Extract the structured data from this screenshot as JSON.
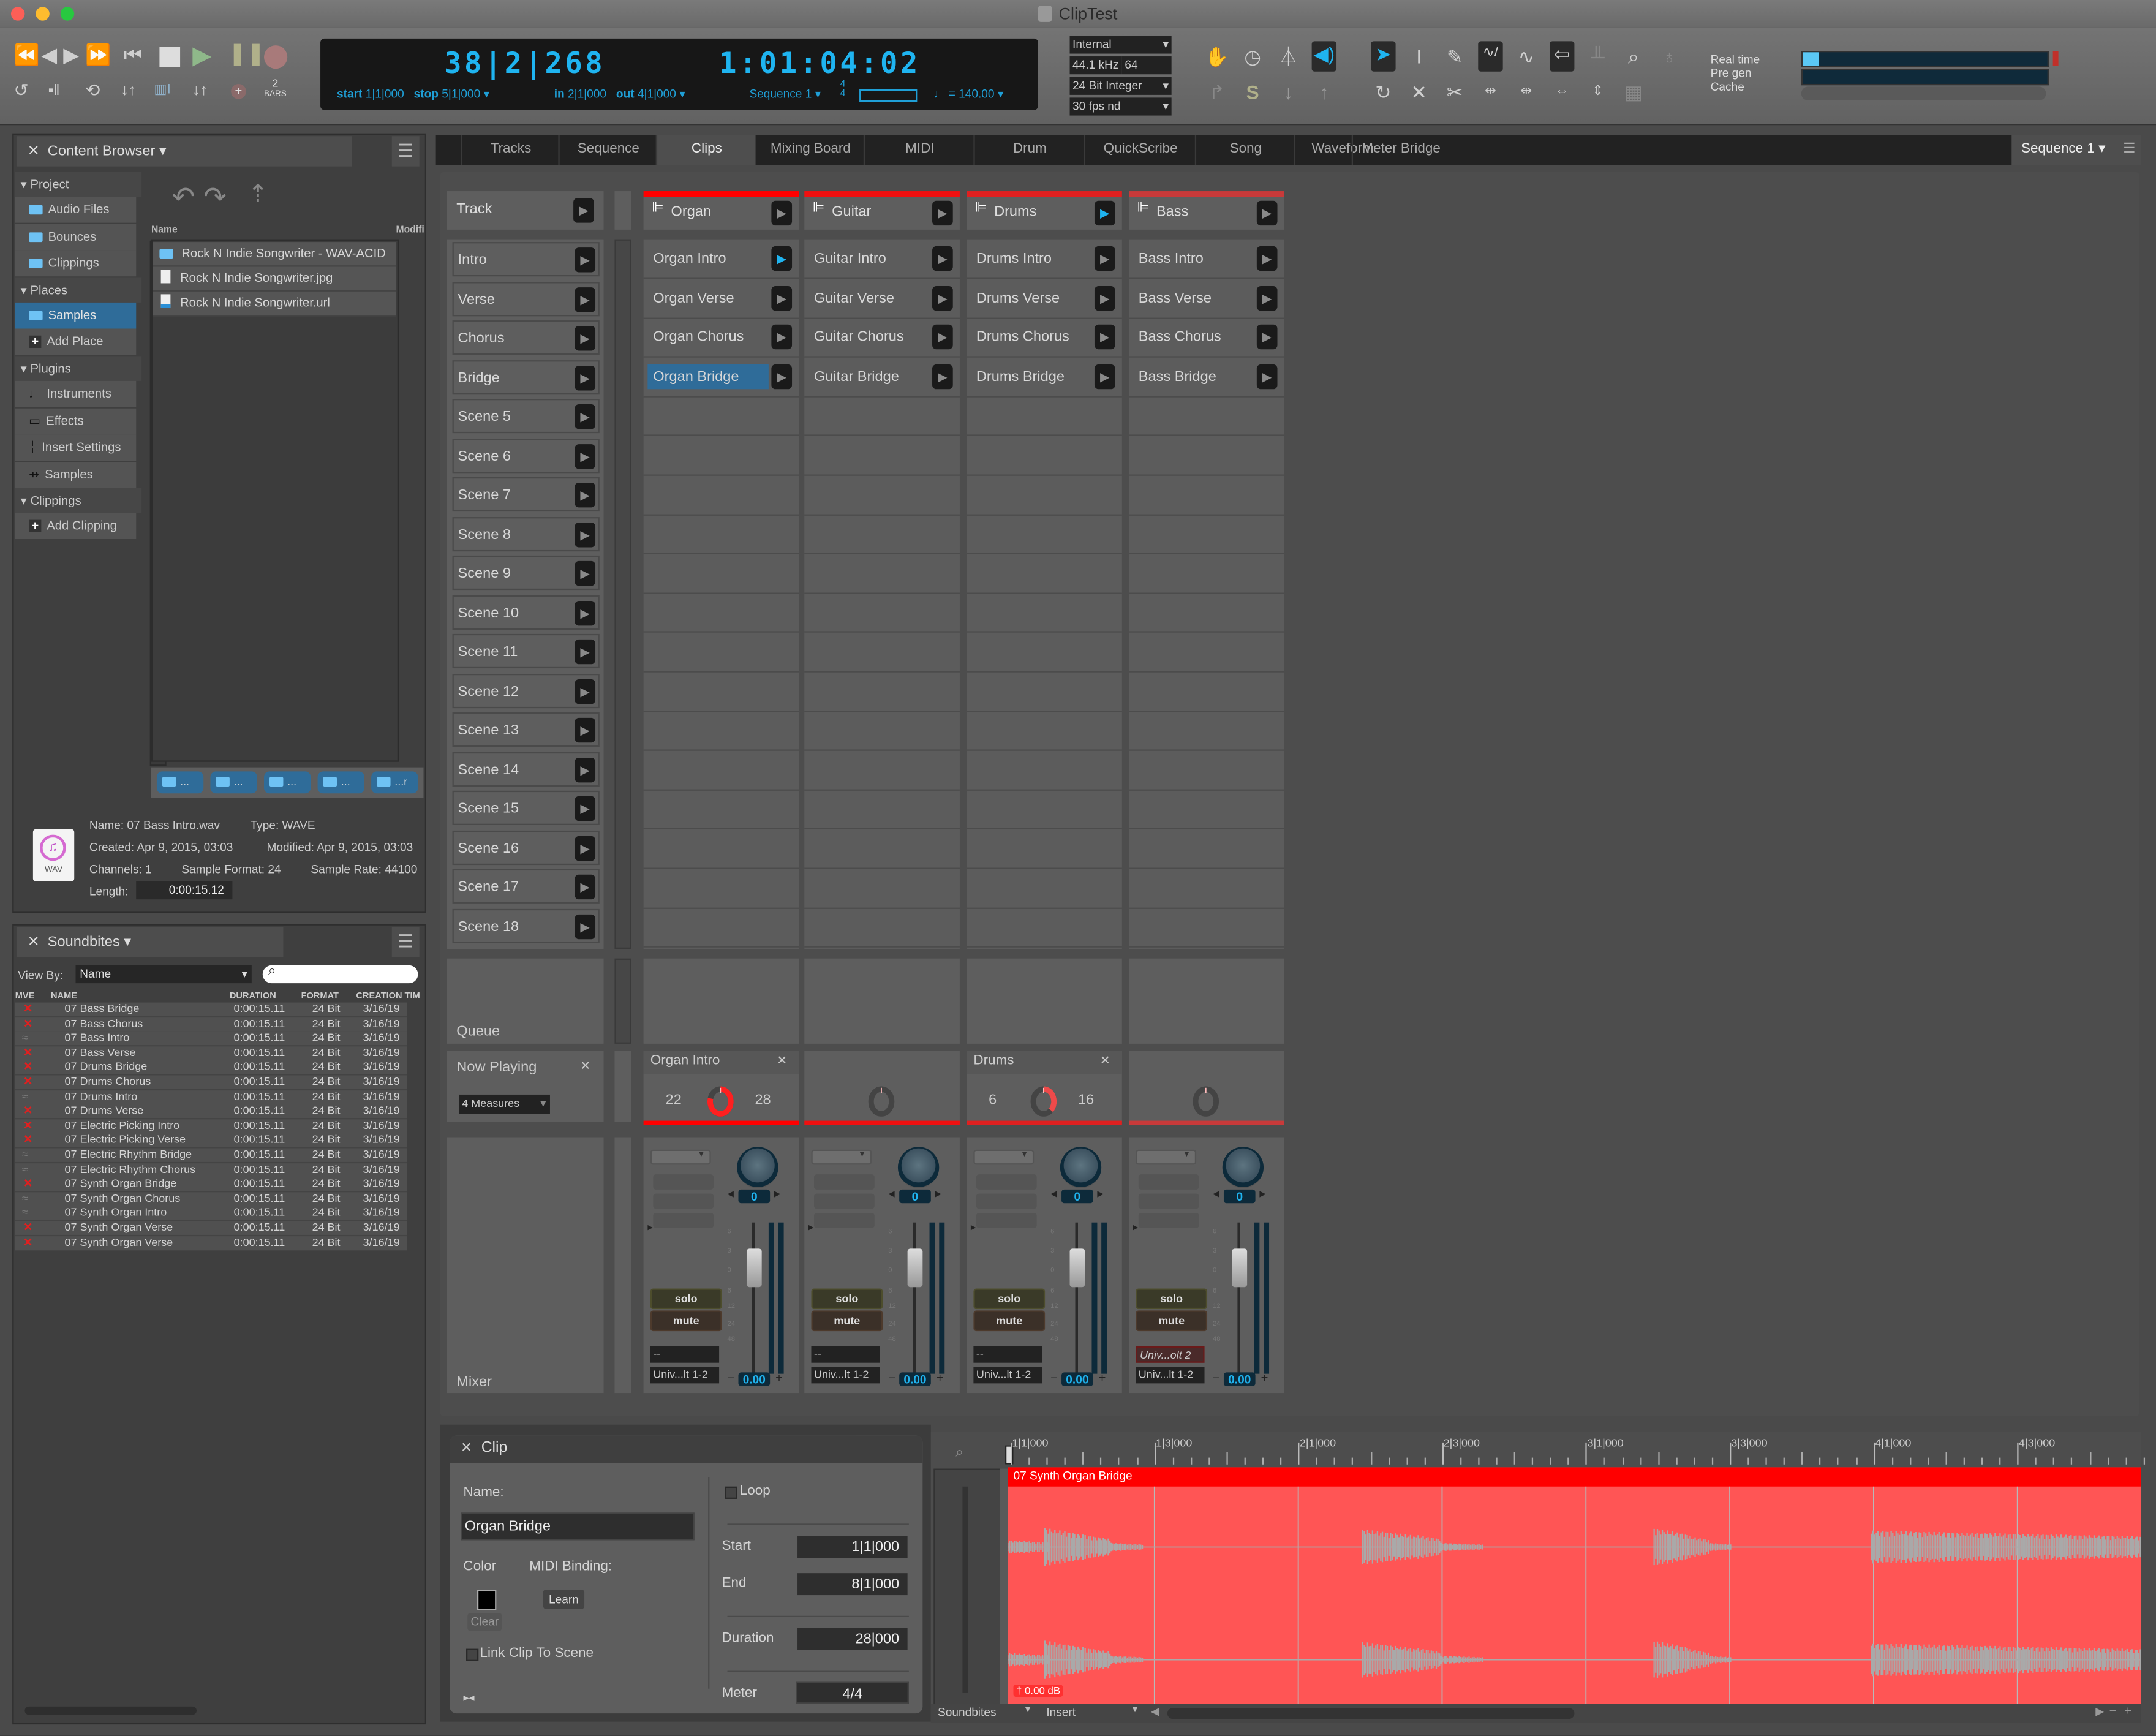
{
  "window": {
    "title": "ClipTest"
  },
  "transport": {
    "position_bars": "38|2|268",
    "position_time": "1:01:04:02",
    "start_label": "start",
    "start_value": "1|1|000",
    "stop_label": "stop",
    "stop_value": "5|1|000",
    "in_label": "in",
    "in_value": "2|1|000",
    "out_label": "out",
    "out_value": "4|1|000",
    "sequence": "Sequence 1",
    "meter_top": "4",
    "meter_bottom": "4",
    "tempo": "= 140.00",
    "bars_count": "2",
    "bars_label": "BARS"
  },
  "audio_settings": {
    "sync": "Internal",
    "sample_rate": "44.1 kHz",
    "buffer": "64",
    "bit_depth": "24 Bit Integer",
    "frame_rate": "30 fps nd"
  },
  "meters": {
    "labels": [
      "Real time",
      "Pre gen",
      "Cache"
    ],
    "realtime_fraction": 0.07,
    "colors": {
      "fill": "#5bc8f5",
      "track": "#0f2a3a",
      "clip": "#c0302a"
    }
  },
  "content_browser": {
    "title": "Content Browser",
    "tree": [
      {
        "type": "header",
        "label": "Project"
      },
      {
        "type": "item",
        "icon": "folder-icon",
        "label": "Audio Files"
      },
      {
        "type": "item",
        "icon": "folder-icon",
        "label": "Bounces"
      },
      {
        "type": "item",
        "icon": "folder-icon",
        "label": "Clippings"
      },
      {
        "type": "header",
        "label": "Places"
      },
      {
        "type": "item",
        "icon": "folder-icon",
        "label": "Samples",
        "selected": true
      },
      {
        "type": "item",
        "icon": "plus-icon",
        "label": "Add Place"
      },
      {
        "type": "header",
        "label": "Plugins"
      },
      {
        "type": "item",
        "icon": "note-icon",
        "label": "Instruments"
      },
      {
        "type": "item",
        "icon": "effects-icon",
        "label": "Effects"
      },
      {
        "type": "item",
        "icon": "insert-icon",
        "label": "Insert Settings"
      },
      {
        "type": "item",
        "icon": "samples-icon",
        "label": "Samples"
      },
      {
        "type": "header",
        "label": "Clippings"
      },
      {
        "type": "item",
        "icon": "plus-icon",
        "label": "Add Clipping"
      }
    ],
    "columns": [
      "Name",
      "Modifi"
    ],
    "files": [
      {
        "icon": "folder-icon",
        "name": "Rock N Indie Songwriter - WAV-ACID"
      },
      {
        "icon": "image-file-icon",
        "name": "Rock N Indie Songwriter.jpg"
      },
      {
        "icon": "url-file-icon",
        "name": "Rock N Indie Songwriter.url"
      }
    ],
    "breadcrumbs": [
      "...",
      "...",
      "...",
      "...",
      "...r"
    ],
    "info": {
      "name": "Name: 07 Bass Intro.wav",
      "type": "Type: WAVE",
      "created": "Created: Apr 9, 2015, 03:03",
      "modified": "Modified: Apr 9, 2015, 03:03",
      "channels": "Channels: 1",
      "sample_format": "Sample Format: 24",
      "sample_rate": "Sample Rate: 44100",
      "length_label": "Length:",
      "length_value": "0:00:15.12",
      "file_badge": "WAV"
    }
  },
  "soundbites": {
    "title": "Soundbites",
    "view_by_label": "View By:",
    "view_by_value": "Name",
    "search_placeholder": "",
    "columns": [
      "MVE",
      "NAME",
      "DURATION",
      "FORMAT",
      "CREATION TIM"
    ],
    "rows": [
      {
        "status": "x",
        "name": "07 Bass Bridge",
        "duration": "0:00:15.11",
        "format": "24 Bit",
        "created": "3/16/19"
      },
      {
        "status": "x",
        "name": "07 Bass Chorus",
        "duration": "0:00:15.11",
        "format": "24 Bit",
        "created": "3/16/19"
      },
      {
        "status": "wave",
        "name": "07 Bass Intro",
        "duration": "0:00:15.11",
        "format": "24 Bit",
        "created": "3/16/19"
      },
      {
        "status": "x",
        "name": "07 Bass Verse",
        "duration": "0:00:15.11",
        "format": "24 Bit",
        "created": "3/16/19"
      },
      {
        "status": "x",
        "name": "07 Drums Bridge",
        "duration": "0:00:15.11",
        "format": "24 Bit",
        "created": "3/16/19"
      },
      {
        "status": "x",
        "name": "07 Drums Chorus",
        "duration": "0:00:15.11",
        "format": "24 Bit",
        "created": "3/16/19"
      },
      {
        "status": "wave",
        "name": "07 Drums Intro",
        "duration": "0:00:15.11",
        "format": "24 Bit",
        "created": "3/16/19"
      },
      {
        "status": "x",
        "name": "07 Drums Verse",
        "duration": "0:00:15.11",
        "format": "24 Bit",
        "created": "3/16/19"
      },
      {
        "status": "x",
        "name": "07 Electric Picking Intro",
        "duration": "0:00:15.11",
        "format": "24 Bit",
        "created": "3/16/19"
      },
      {
        "status": "x",
        "name": "07 Electric Picking Verse",
        "duration": "0:00:15.11",
        "format": "24 Bit",
        "created": "3/16/19"
      },
      {
        "status": "wave",
        "name": "07 Electric Rhythm Bridge",
        "duration": "0:00:15.11",
        "format": "24 Bit",
        "created": "3/16/19"
      },
      {
        "status": "wave",
        "name": "07 Electric Rhythm Chorus",
        "duration": "0:00:15.11",
        "format": "24 Bit",
        "created": "3/16/19"
      },
      {
        "status": "x",
        "name": "07 Synth Organ Bridge",
        "duration": "0:00:15.11",
        "format": "24 Bit",
        "created": "3/16/19"
      },
      {
        "status": "wave",
        "name": "07 Synth Organ Chorus",
        "duration": "0:00:15.11",
        "format": "24 Bit",
        "created": "3/16/19"
      },
      {
        "status": "wave",
        "name": "07 Synth Organ Intro",
        "duration": "0:00:15.11",
        "format": "24 Bit",
        "created": "3/16/19"
      },
      {
        "status": "x",
        "name": "07 Synth Organ Verse",
        "duration": "0:00:15.11",
        "format": "24 Bit",
        "created": "3/16/19"
      },
      {
        "status": "x",
        "name": "07 Synth Organ Verse",
        "duration": "0:00:15.11",
        "format": "24 Bit",
        "created": "3/16/19"
      }
    ]
  },
  "tabs": {
    "items": [
      "Tracks",
      "Sequence",
      "Clips",
      "Mixing Board",
      "MIDI",
      "Drum",
      "QuickScribe",
      "Song",
      "Waveform",
      "Meter Bridge"
    ],
    "active": "Clips",
    "sequence_selector": "Sequence 1"
  },
  "clips": {
    "track_header_label": "Track",
    "tracks": [
      {
        "name": "Organ",
        "color": "#ff0000",
        "play_active": false
      },
      {
        "name": "Guitar",
        "color": "#f01010",
        "play_active": false
      },
      {
        "name": "Drums",
        "color": "#e02020",
        "play_active": true
      },
      {
        "name": "Bass",
        "color": "#c83a3a",
        "play_active": false
      }
    ],
    "scenes": [
      "Intro",
      "Verse",
      "Chorus",
      "Bridge",
      "Scene 5",
      "Scene 6",
      "Scene 7",
      "Scene 8",
      "Scene 9",
      "Scene 10",
      "Scene 11",
      "Scene 12",
      "Scene 13",
      "Scene 14",
      "Scene 15",
      "Scene 16",
      "Scene 17",
      "Scene 18"
    ],
    "grid": [
      [
        "Organ Intro",
        "Guitar Intro",
        "Drums Intro",
        "Bass Intro"
      ],
      [
        "Organ Verse",
        "Guitar Verse",
        "Drums Verse",
        "Bass Verse"
      ],
      [
        "Organ Chorus",
        "Guitar Chorus",
        "Drums Chorus",
        "Bass Chorus"
      ],
      [
        "Organ Bridge",
        "Guitar Bridge",
        "Drums Bridge",
        "Bass Bridge"
      ]
    ],
    "playing_clip": "Organ Intro",
    "selected_clip": "Organ Bridge",
    "queue_label": "Queue",
    "now_playing_label": "Now Playing",
    "quantize": "4 Measures",
    "now_playing": [
      {
        "clip": "Organ Intro",
        "current": "22",
        "total": "28",
        "progress": 0.79
      },
      {
        "clip": "",
        "current": "",
        "total": "",
        "progress": 0
      },
      {
        "clip": "Drums",
        "current": "6",
        "total": "16",
        "progress": 0.375
      },
      {
        "clip": "",
        "current": "",
        "total": "",
        "progress": 0
      }
    ],
    "mixer_label": "Mixer",
    "mixer": [
      {
        "pan": "0",
        "volume": "0.00",
        "solo": "solo",
        "mute": "mute",
        "input": "--",
        "output": "Univ...lt 1-2"
      },
      {
        "pan": "0",
        "volume": "0.00",
        "solo": "solo",
        "mute": "mute",
        "input": "--",
        "output": "Univ...lt 1-2"
      },
      {
        "pan": "0",
        "volume": "0.00",
        "solo": "solo",
        "mute": "mute",
        "input": "--",
        "output": "Univ...lt 1-2"
      },
      {
        "pan": "0",
        "volume": "0.00",
        "solo": "solo",
        "mute": "mute",
        "input": "Univ...olt 2",
        "output": "Univ...lt 1-2",
        "input_warning": true
      }
    ],
    "fader_scale": [
      "6",
      "3",
      "0",
      "6",
      "12",
      "24",
      "48"
    ]
  },
  "clip_inspector": {
    "title": "Clip",
    "name_label": "Name:",
    "name_value": "Organ Bridge",
    "loop_label": "Loop",
    "color_label": "Color",
    "color_value": "#000000",
    "clear_label": "Clear",
    "midi_binding_label": "MIDI Binding:",
    "learn_label": "Learn",
    "link_label": "Link Clip To Scene",
    "start_label": "Start",
    "start_value": "1|1|000",
    "end_label": "End",
    "end_value": "8|1|000",
    "duration_label": "Duration",
    "duration_value": "28|000",
    "meter_label": "Meter",
    "meter_value": "4/4"
  },
  "waveform": {
    "ruler": [
      "1|1|000",
      "1|3|000",
      "2|1|000",
      "2|3|000",
      "3|1|000",
      "3|3|000",
      "4|1|000",
      "4|3|000"
    ],
    "region_name": "07 Synth Organ Bridge",
    "gain": "0.00 dB",
    "region_color": "#ff5555",
    "header_color": "#ff0000",
    "footer_left": "Soundbites",
    "footer_mode": "Insert"
  }
}
